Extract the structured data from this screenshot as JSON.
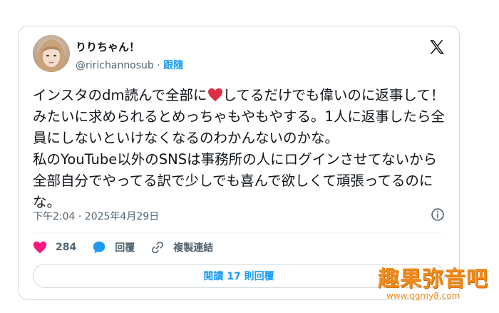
{
  "user": {
    "display_name": "りりちゃん！",
    "handle": "@ririchannosub",
    "separator": "·",
    "follow_label": "跟隨"
  },
  "tweet": {
    "text_before_emoji": "インスタのdm読んで全部に",
    "emoji": "red-heart",
    "text_after_emoji": "してるだけでも偉いのに返事して！みたいに求められるとめっちゃもやもやする。1人に返事したら全員にしないといけなくなるのわかんないのかな。\n私のYouTube以外のSNSは事務所の人にログインさせてないから全部自分でやってる訳で少しでも喜んで欲しくて頑張ってるのにな。",
    "timestamp": "下午2:04 · 2025年4月29日"
  },
  "actions": {
    "like_count": "284",
    "reply_label": "回覆",
    "copy_link_label": "複製連結"
  },
  "read_replies_label": "閱讀 17 則回覆",
  "watermark": {
    "title": "趣果弥音吧",
    "url": "www.qgmy8.com"
  },
  "colors": {
    "accent": "#1d9bf0",
    "like": "#f91880",
    "text": "#0f1419",
    "muted": "#536471",
    "watermark": "#f08a1c"
  }
}
